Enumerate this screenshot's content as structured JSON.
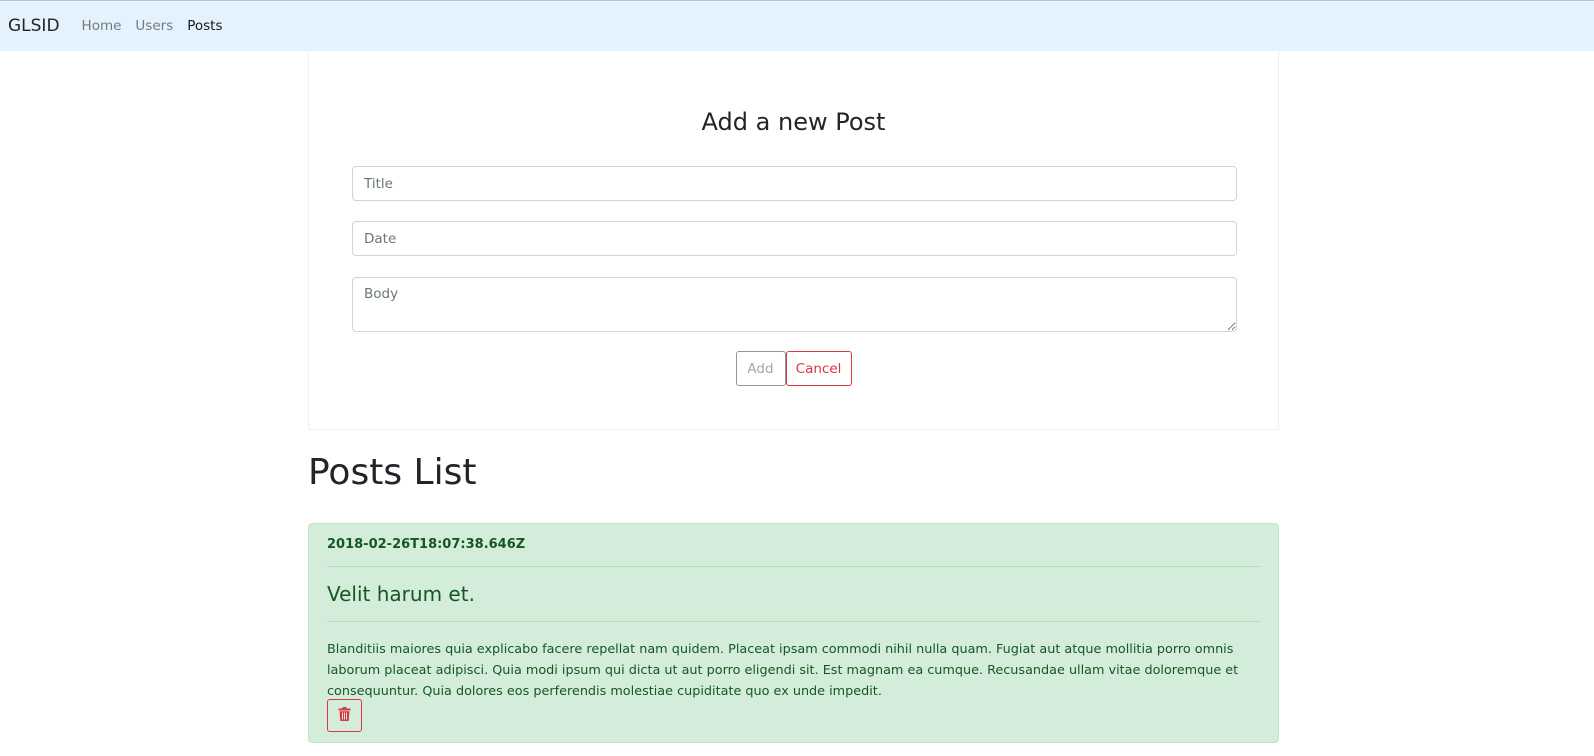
{
  "navbar": {
    "brand": "GLSID",
    "links": [
      {
        "label": "Home",
        "active": false
      },
      {
        "label": "Users",
        "active": false
      },
      {
        "label": "Posts",
        "active": true
      }
    ]
  },
  "form": {
    "title": "Add a new Post",
    "title_placeholder": "Title",
    "date_placeholder": "Date",
    "body_placeholder": "Body",
    "add_label": "Add",
    "cancel_label": "Cancel"
  },
  "list": {
    "heading": "Posts List",
    "posts": [
      {
        "date": "2018-02-26T18:07:38.646Z",
        "title": "Velit harum et.",
        "body": "Blanditiis maiores quia explicabo facere repellat nam quidem. Placeat ipsam commodi nihil nulla quam. Fugiat aut atque mollitia porro omnis laborum placeat adipisci. Quia modi ipsum qui dicta ut aut porro eligendi sit. Est magnam ea cumque. Recusandae ullam vitae doloremque et consequuntur. Quia dolores eos perferendis molestiae cupiditate quo ex unde impedit.",
        "delete_icon": "trash-icon"
      }
    ]
  },
  "colors": {
    "navbar_bg": "#e3f2fd",
    "success_bg": "#d4edda",
    "success_text": "#155724",
    "danger": "#dc3545"
  }
}
